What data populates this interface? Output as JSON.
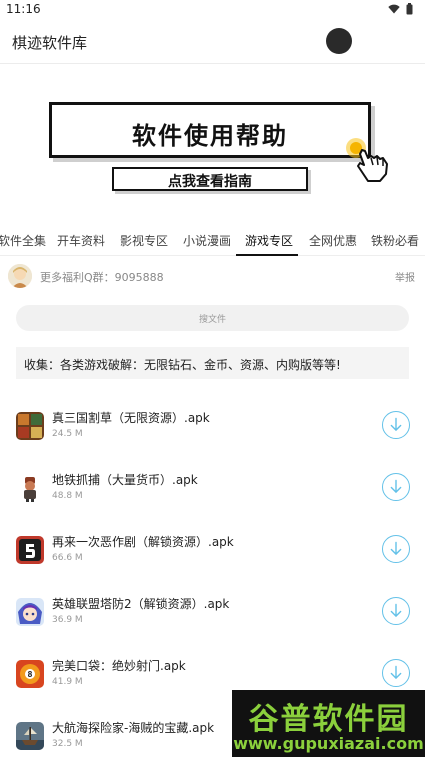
{
  "status_bar": {
    "time": "11:16",
    "icons": [
      "wifi-icon",
      "battery-icon"
    ]
  },
  "app": {
    "title": "棋迹软件库"
  },
  "banner": {
    "title": "软件使用帮助",
    "button_label": "点我查看指南"
  },
  "tabs": {
    "items": [
      {
        "label": "软件全集",
        "active": false
      },
      {
        "label": "开车资料",
        "active": false
      },
      {
        "label": "影视专区",
        "active": false
      },
      {
        "label": "小说漫画",
        "active": false
      },
      {
        "label": "游戏专区",
        "active": true
      },
      {
        "label": "全网优惠",
        "active": false
      },
      {
        "label": "铁粉必看",
        "active": false
      }
    ]
  },
  "group": {
    "text": "更多福利Q群：9095888",
    "report_label": "举报"
  },
  "search": {
    "placeholder": "搜文件"
  },
  "notice": {
    "text": "收集：各类游戏破解：无限钻石、金币、资源、内购版等等!"
  },
  "files": [
    {
      "name": "真三国割草（无限资源）.apk",
      "size": "24.5 M",
      "icon": "three-kingdoms-game-icon"
    },
    {
      "name": "地铁抓捕（大量货币）.apk",
      "size": "48.8 M",
      "icon": "subway-runner-game-icon"
    },
    {
      "name": "再来一次恶作剧（解锁资源）.apk",
      "size": "66.6 M",
      "icon": "prank-game-icon"
    },
    {
      "name": "英雄联盟塔防2（解锁资源）.apk",
      "size": "36.9 M",
      "icon": "anime-hero-game-icon"
    },
    {
      "name": "完美口袋：绝妙射门.apk",
      "size": "41.9 M",
      "icon": "billiard-8-ball-icon"
    },
    {
      "name": "大航海探险家-海贼的宝藏.apk",
      "size": "32.5 M",
      "icon": "pirate-ship-game-icon"
    }
  ],
  "watermark": {
    "title": "谷普软件园",
    "url": "www.gupuxiazai.com"
  },
  "colors": {
    "accent": "#63c1e8",
    "text": "#222222",
    "muted": "#999999",
    "watermark": "#8bd03c"
  }
}
